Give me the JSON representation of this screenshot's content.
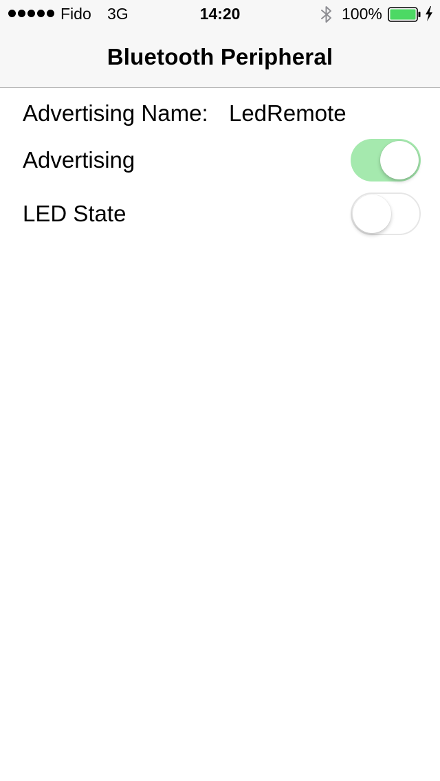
{
  "status_bar": {
    "carrier": "Fido",
    "network": "3G",
    "time": "14:20",
    "battery_percent": "100%",
    "signal_icon": "signal-dots-icon",
    "bluetooth_icon": "bluetooth-icon",
    "battery_icon": "battery-icon",
    "charging_icon": "charging-bolt-icon",
    "battery_color": "#4cd964"
  },
  "nav": {
    "title": "Bluetooth Peripheral"
  },
  "settings": {
    "advertising_name_label": "Advertising Name:",
    "advertising_name_value": "LedRemote",
    "advertising_label": "Advertising",
    "advertising_on": true,
    "led_state_label": "LED State",
    "led_state_on": false,
    "switch_on_color": "#a5e9ae"
  }
}
